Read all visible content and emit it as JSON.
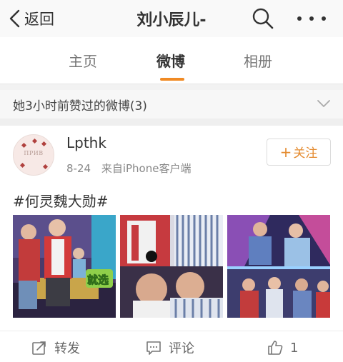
{
  "navbar": {
    "back_label": "返回",
    "title": "刘小辰儿-"
  },
  "tabs": [
    {
      "label": "主页",
      "active": false
    },
    {
      "label": "微博",
      "active": true
    },
    {
      "label": "相册",
      "active": false
    }
  ],
  "liked_header": {
    "text": "她3小时前赞过的微博(3)"
  },
  "post": {
    "username": "Lpthk",
    "date": "8-24",
    "source": "来自iPhone客户端",
    "follow_label": "关注",
    "follow_plus": "+",
    "hashtag": "#何灵魏大勋#",
    "avatar_text": "ПРИВ",
    "photo_caption": "就选",
    "actions": {
      "repost": "转发",
      "comment": "评论",
      "like_count": "1"
    }
  },
  "colors": {
    "accent": "#f08a24",
    "follow_text": "#e48a2e",
    "text": "#333333",
    "muted": "#888888"
  },
  "icons": [
    "chevron-left-icon",
    "search-icon",
    "more-icon",
    "chevron-down-icon",
    "repost-icon",
    "comment-icon",
    "thumbs-up-icon"
  ]
}
